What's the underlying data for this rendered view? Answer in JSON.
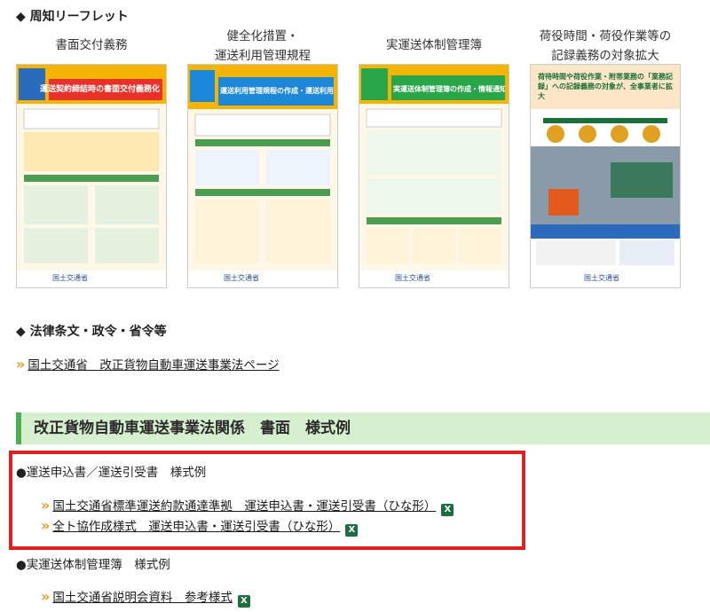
{
  "leaflet_section": {
    "heading": "◆ 周知リーフレット",
    "items": [
      {
        "title_lines": [
          "書面交付義務"
        ],
        "banner": "運送契約締結時の書面交付義務化",
        "header_color": "#e8312a",
        "footer": "国土交通省"
      },
      {
        "title_lines": [
          "健全化措置・",
          "運送利用管理規程"
        ],
        "banner": "運送利用管理規程の作成・運送利用管理者の選任義務化",
        "header_color": "#1e88d8",
        "footer": "国土交通省"
      },
      {
        "title_lines": [
          "実運送体制管理簿"
        ],
        "banner": "実運送体制管理簿の作成・情報通知の義務化",
        "header_color": "#2aa64a",
        "footer": "国土交通省"
      },
      {
        "title_lines": [
          "荷役時間・荷役作業等の",
          "記録義務の対象拡大"
        ],
        "banner": "荷待時間や荷役作業・附帯業務の「業務記録」への記録義務の対象が、全事業者に拡大",
        "header_color": "#1a6f3a",
        "footer": "国土交通省"
      }
    ]
  },
  "law_section": {
    "heading": "◆ 法律条文・政令・省令等",
    "link": "国土交通省　改正貨物自動車運送事業法ページ"
  },
  "forms_section": {
    "title": "改正貨物自動車運送事業法関係　書面　様式例",
    "groups": [
      {
        "label": "●運送申込書／運送引受書　様式例",
        "links": [
          "国土交通省標準運送約款通達準拠　運送申込書・運送引受書（ひな形）",
          "全ト協作成様式　運送申込書・運送引受書（ひな形）"
        ]
      },
      {
        "label": "●実運送体制管理簿　様式例",
        "links": [
          "国土交通省説明会資料　参考様式"
        ]
      }
    ]
  },
  "icons": {
    "chevron": "»",
    "excel": "X"
  },
  "colors": {
    "highlight_border": "#e02020",
    "section_bar": "#d6efcf",
    "chevron": "#e0a020"
  }
}
